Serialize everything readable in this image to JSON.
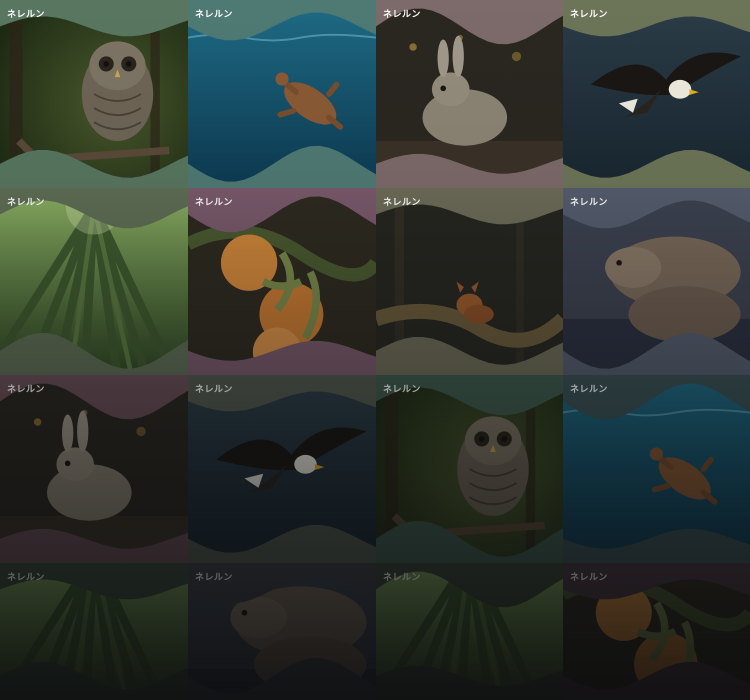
{
  "gallery": {
    "tiles": [
      {
        "label": "ネレルン",
        "subject": "owl",
        "wave_color": "#587660"
      },
      {
        "label": "ネレルン",
        "subject": "turtle",
        "wave_color": "#4f7a74"
      },
      {
        "label": "ネレルン",
        "subject": "rabbit",
        "wave_color": "#7d6a6a"
      },
      {
        "label": "ネレルン",
        "subject": "eagle",
        "wave_color": "#6d7558"
      },
      {
        "label": "ネレルン",
        "subject": "bamboo",
        "wave_color": "#5f6e55"
      },
      {
        "label": "ネレルン",
        "subject": "oranges",
        "wave_color": "#7a5a6c"
      },
      {
        "label": "ネレルン",
        "subject": "fox",
        "wave_color": "#6d6c58"
      },
      {
        "label": "ネレルン",
        "subject": "otters",
        "wave_color": "#555d6e"
      },
      {
        "label": "ネレルン",
        "subject": "rabbit",
        "wave_color": "#6a4f58"
      },
      {
        "label": "ネレルン",
        "subject": "eagle",
        "wave_color": "#525a4f"
      },
      {
        "label": "ネレルン",
        "subject": "owl",
        "wave_color": "#3f5c4e"
      },
      {
        "label": "ネレルン",
        "subject": "turtle",
        "wave_color": "#3a5255"
      },
      {
        "label": "ネレルン",
        "subject": "bamboo",
        "wave_color": "#3a4a3c"
      },
      {
        "label": "ネレルン",
        "subject": "otters",
        "wave_color": "#3d4149"
      },
      {
        "label": "ネレルン",
        "subject": "bamboo",
        "wave_color": "#3a4538"
      },
      {
        "label": "ネレルン",
        "subject": "oranges",
        "wave_color": "#4a3944"
      }
    ]
  }
}
